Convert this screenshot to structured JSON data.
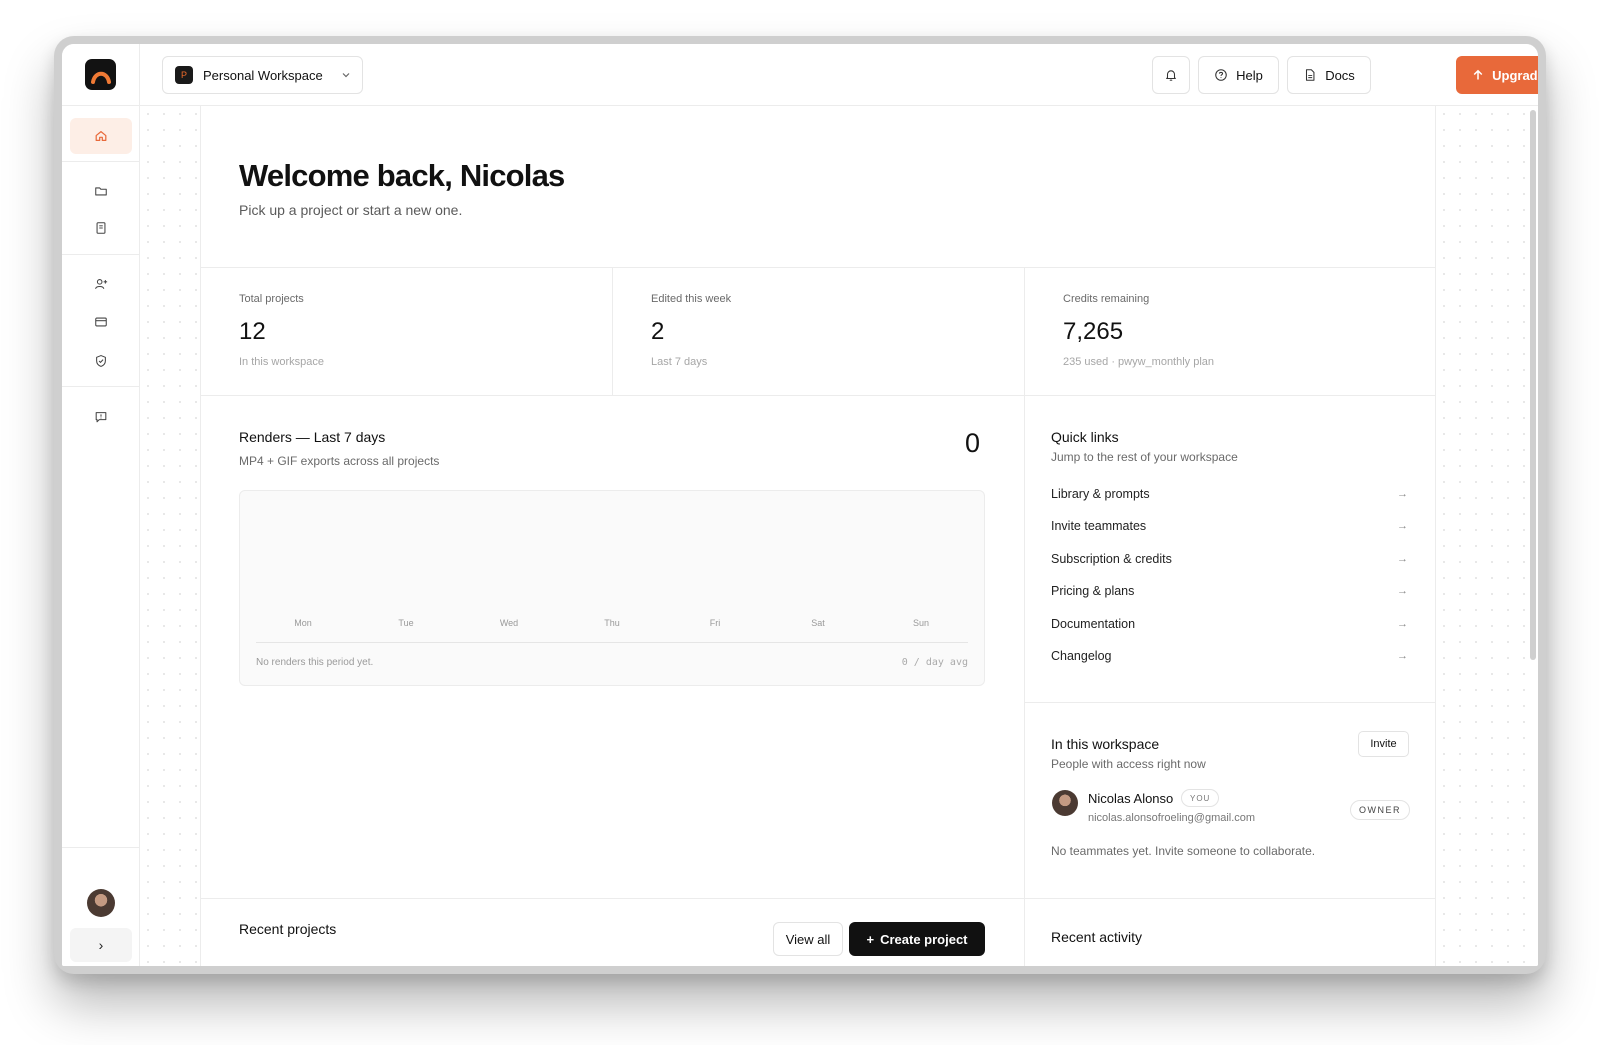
{
  "workspace": {
    "badge": "P",
    "name": "Personal Workspace"
  },
  "topbar": {
    "help": "Help",
    "docs": "Docs",
    "upgrade": "Upgrade"
  },
  "welcome": {
    "title": "Welcome back, Nicolas",
    "subtitle": "Pick up a project or start a new one."
  },
  "stats": [
    {
      "label": "Total projects",
      "value": "12",
      "note": "In this workspace"
    },
    {
      "label": "Edited this week",
      "value": "2",
      "note": "Last 7 days"
    },
    {
      "label": "Credits remaining",
      "value": "7,265",
      "note": "235 used · pwyw_monthly plan"
    }
  ],
  "renders": {
    "title": "Renders — Last 7 days",
    "subtitle": "MP4 + GIF exports across all projects",
    "count": "0",
    "days": [
      "Mon",
      "Tue",
      "Wed",
      "Thu",
      "Fri",
      "Sat",
      "Sun"
    ],
    "empty": "No renders this period yet.",
    "avg": "0 / day avg"
  },
  "quick_links": {
    "title": "Quick links",
    "subtitle": "Jump to the rest of your workspace",
    "items": [
      {
        "label": "Library & prompts"
      },
      {
        "label": "Invite teammates"
      },
      {
        "label": "Subscription & credits"
      },
      {
        "label": "Pricing & plans"
      },
      {
        "label": "Documentation"
      },
      {
        "label": "Changelog"
      }
    ]
  },
  "members": {
    "title": "In this workspace",
    "subtitle": "People with access right now",
    "invite": "Invite",
    "member": {
      "name": "Nicolas Alonso",
      "you": "YOU",
      "email": "nicolas.alonsofroeling@gmail.com",
      "role": "OWNER"
    },
    "empty": "No teammates yet. Invite someone to collaborate."
  },
  "recent": {
    "projects_title": "Recent projects",
    "view_all": "View all",
    "create": "Create project",
    "activity_title": "Recent activity"
  },
  "colors": {
    "accent": "#e8693a",
    "active_bg": "#fdeee6"
  },
  "sidebar": {
    "icons": [
      "home-icon",
      "folder-icon",
      "book-icon",
      "user-plus-icon",
      "credit-card-icon",
      "shield-icon",
      "message-icon"
    ],
    "expand": "›"
  }
}
